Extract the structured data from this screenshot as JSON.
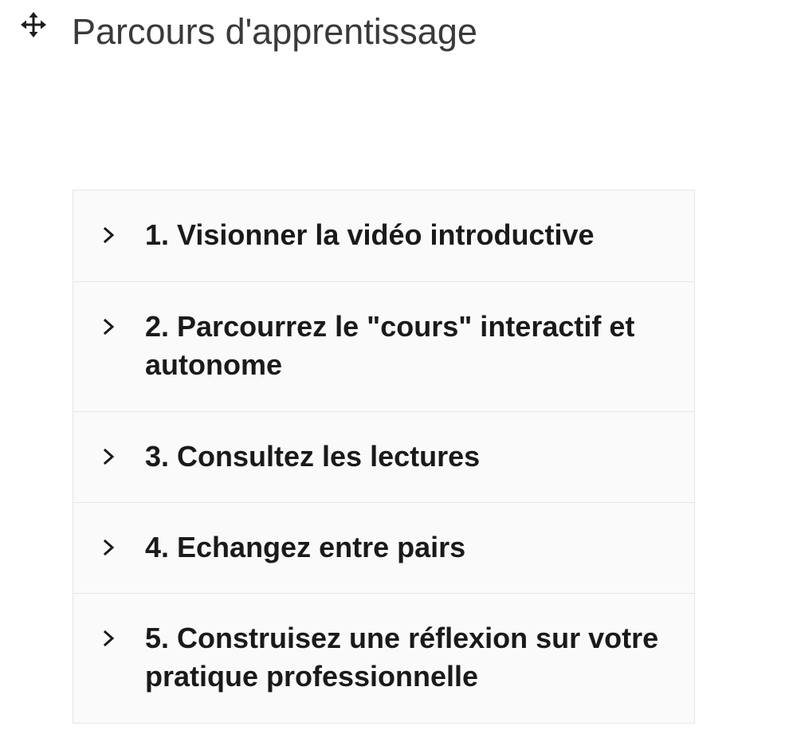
{
  "header": {
    "title": "Parcours d'apprentissage",
    "drag_icon": "move-arrows-icon"
  },
  "accordion": {
    "items": [
      {
        "label": "1. Visionner la vidéo introductive",
        "icon": "chevron-right-icon",
        "expanded": false
      },
      {
        "label": "2. Parcourrez le \"cours\" interactif et autonome",
        "icon": "chevron-right-icon",
        "expanded": false
      },
      {
        "label": "3. Consultez les lectures",
        "icon": "chevron-right-icon",
        "expanded": false
      },
      {
        "label": "4. Echangez entre pairs",
        "icon": "chevron-right-icon",
        "expanded": false
      },
      {
        "label": "5. Construisez une réflexion sur votre pratique professionnelle",
        "icon": "chevron-right-icon",
        "expanded": false
      }
    ]
  },
  "colors": {
    "title_text": "#3a3a3a",
    "item_text": "#1a1a1a",
    "item_background": "#fafafa",
    "border": "#e6e6e6"
  }
}
